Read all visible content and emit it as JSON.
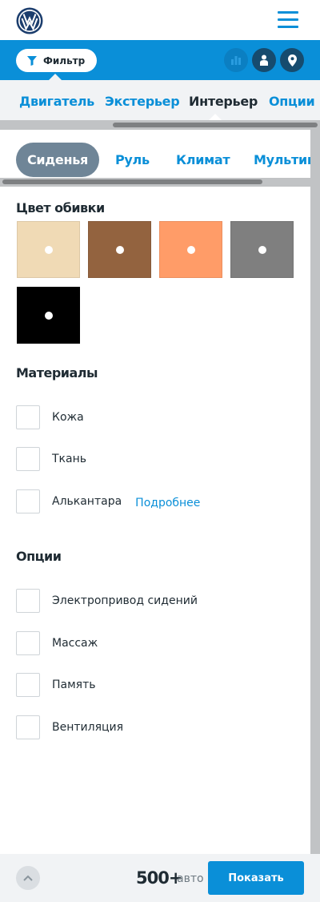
{
  "header": {
    "logo": "VW",
    "menu_icon": "hamburger-menu-icon"
  },
  "filterbar": {
    "filter_label": "Фильтр",
    "filter_icon": "funnel-icon",
    "actions": [
      {
        "icon": "bar-chart-icon"
      },
      {
        "icon": "user-icon"
      },
      {
        "icon": "location-pin-icon"
      }
    ]
  },
  "tabs": [
    {
      "label": "Двигатель",
      "active": false
    },
    {
      "label": "Экстерьер",
      "active": false
    },
    {
      "label": "Интерьер",
      "active": true
    },
    {
      "label": "Опции",
      "active": false
    }
  ],
  "subtabs": [
    {
      "label": "Сиденья",
      "active": true
    },
    {
      "label": "Руль",
      "active": false
    },
    {
      "label": "Климат",
      "active": false
    },
    {
      "label": "Мультимедиа",
      "active": false
    }
  ],
  "upholstery": {
    "title": "Цвет обивки",
    "colors": [
      "#f0dab5",
      "#93633f",
      "#ff9c68",
      "#7f7f7f",
      "#000000"
    ]
  },
  "materials": {
    "title": "Материалы",
    "items": [
      {
        "label": "Кожа"
      },
      {
        "label": "Ткань"
      },
      {
        "label": "Алькантара",
        "link": "Подробнее"
      }
    ]
  },
  "options": {
    "title": "Опции",
    "items": [
      {
        "label": "Электропривод сидений"
      },
      {
        "label": "Массаж"
      },
      {
        "label": "Память"
      },
      {
        "label": "Вентиляция"
      }
    ]
  },
  "footer": {
    "count": "500+",
    "unit": "авто",
    "show_label": "Показать",
    "up_icon": "chevron-up-icon"
  },
  "colors": {
    "accent": "#0a8fd8",
    "dark_blue": "#164b6e",
    "pill_active": "#6f8597",
    "text": "#1f2b33"
  }
}
